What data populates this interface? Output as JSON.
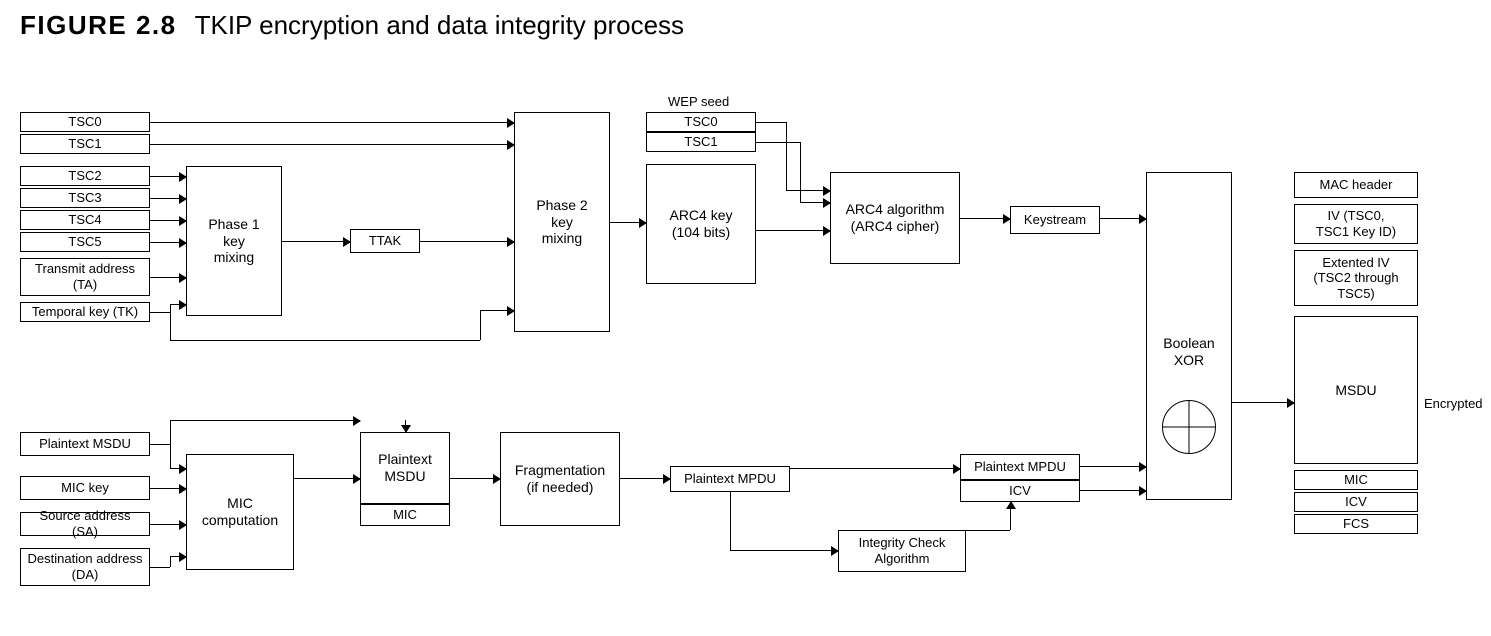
{
  "figure_number": "FIGURE 2.8",
  "figure_title": "TKIP encryption and data integrity process",
  "inputs_top": [
    "TSC0",
    "TSC1",
    "TSC2",
    "TSC3",
    "TSC4",
    "TSC5"
  ],
  "input_ta": "Transmit address (TA)",
  "input_tk": "Temporal key (TK)",
  "phase1": "Phase 1\nkey\nmixing",
  "ttak": "TTAK",
  "phase2": "Phase 2\nkey\nmixing",
  "wep_seed_label": "WEP seed",
  "wep_seed": {
    "tsc0": "TSC0",
    "tsc1": "TSC1",
    "arc4key": "ARC4 key\n(104 bits)"
  },
  "arc4": "ARC4 algorithm\n(ARC4 cipher)",
  "keystream": "Keystream",
  "xor_label": "Boolean\nXOR",
  "encrypted_label": "Encrypted",
  "output": {
    "mac": "MAC header",
    "iv": "IV (TSC0,\nTSC1 Key ID)",
    "eiv": "Extented IV\n(TSC2 through\nTSC5)",
    "msdu": "MSDU",
    "mic": "MIC",
    "icv": "ICV",
    "fcs": "FCS"
  },
  "inputs_bottom": [
    "Plaintext MSDU",
    "MIC key",
    "Source address (SA)",
    "Destination address (DA)"
  ],
  "mic_comp": "MIC\ncomputation",
  "plaintext_msdu": "Plaintext\nMSDU",
  "mic_small": "MIC",
  "fragmentation": "Fragmentation\n(if needed)",
  "plaintext_mpdu": "Plaintext MPDU",
  "integrity_check": "Integrity Check\nAlgorithm",
  "mpdu_icv": {
    "mpdu": "Plaintext MPDU",
    "icv": "ICV"
  }
}
